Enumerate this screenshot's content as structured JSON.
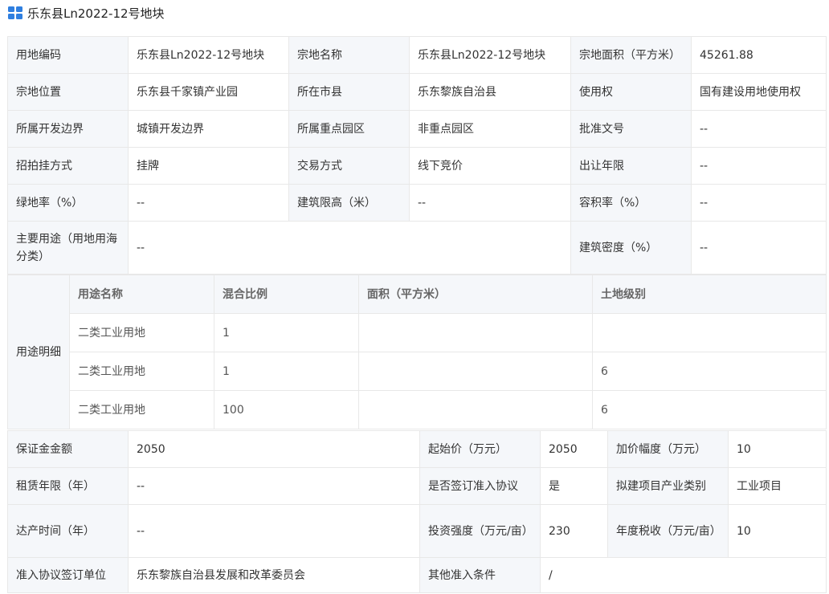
{
  "header": {
    "title": "乐东县Ln2022-12号地块",
    "icon": "database-icon"
  },
  "colors": {
    "label_bg": "#f5f7fa",
    "border": "#e8e8e8",
    "icon": "#2f7fe0"
  },
  "info": {
    "row1": {
      "l1": "用地编码",
      "v1": "乐东县Ln2022-12号地块",
      "l2": "宗地名称",
      "v2": "乐东县Ln2022-12号地块",
      "l3": "宗地面积（平方米）",
      "v3": "45261.88"
    },
    "row2": {
      "l1": "宗地位置",
      "v1": "乐东县千家镇产业园",
      "l2": "所在市县",
      "v2": "乐东黎族自治县",
      "l3": "使用权",
      "v3": "国有建设用地使用权"
    },
    "row3": {
      "l1": "所属开发边界",
      "v1": "城镇开发边界",
      "l2": "所属重点园区",
      "v2": "非重点园区",
      "l3": "批准文号",
      "v3": "--"
    },
    "row4": {
      "l1": "招拍挂方式",
      "v1": "挂牌",
      "l2": "交易方式",
      "v2": "线下竞价",
      "l3": "出让年限",
      "v3": "--"
    },
    "row5": {
      "l1": "绿地率（%）",
      "v1": "--",
      "l2": "建筑限高（米）",
      "v2": "--",
      "l3": "容积率（%）",
      "v3": "--"
    },
    "row6": {
      "l1": "主要用途（用地用海分类）",
      "v1": "--",
      "l3": "建筑密度（%）",
      "v3": "--"
    }
  },
  "usage": {
    "label": "用途明细",
    "headers": [
      "用途名称",
      "混合比例",
      "面积（平方米）",
      "土地级别"
    ],
    "rows": [
      [
        "二类工业用地",
        "1",
        "",
        ""
      ],
      [
        "二类工业用地",
        "1",
        "",
        "6"
      ],
      [
        "二类工业用地",
        "100",
        "",
        "6"
      ]
    ]
  },
  "price": {
    "row1": {
      "l1": "保证金金额",
      "v1": "2050",
      "l2": "起始价（万元）",
      "v2": "2050",
      "l3": "加价幅度（万元）",
      "v3": "10"
    },
    "row2": {
      "l1": "租赁年限（年）",
      "v1": "--",
      "l2": "是否签订准入协议",
      "v2": "是",
      "l3": "拟建项目产业类别",
      "v3": "工业项目"
    },
    "row3": {
      "l1": "达产时间（年）",
      "v1": "--",
      "l2": "投资强度（万元/亩）",
      "v2": "230",
      "l3": "年度税收（万元/亩）",
      "v3": "10"
    },
    "row4": {
      "l1": "准入协议签订单位",
      "v1": "乐东黎族自治县发展和改革委员会",
      "l2": "其他准入条件",
      "v2": "/"
    }
  }
}
